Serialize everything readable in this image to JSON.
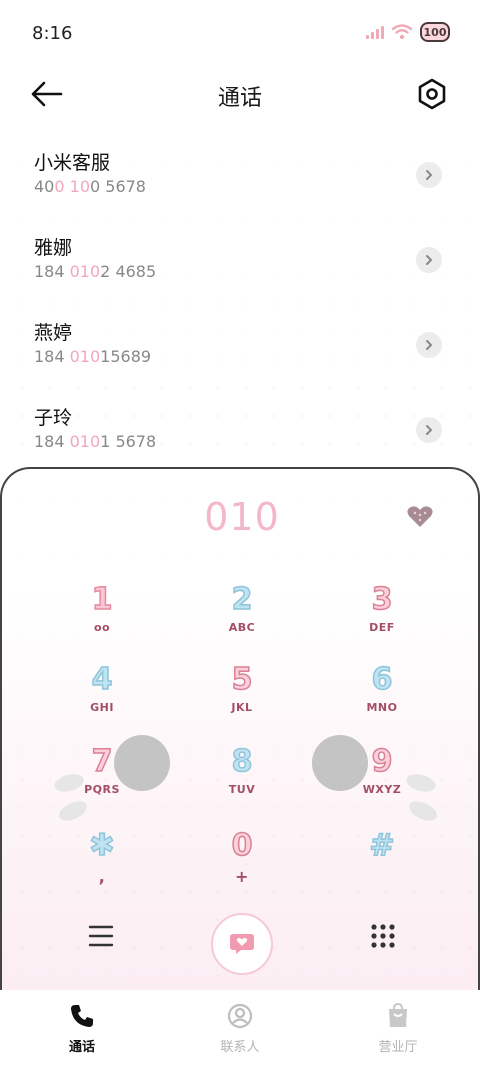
{
  "status_bar": {
    "time": "8:16",
    "battery": "100"
  },
  "header": {
    "title": "通话"
  },
  "contacts": [
    {
      "name": "小米客服",
      "number_parts": [
        "40",
        "0",
        " ",
        "10",
        "0 5678"
      ]
    },
    {
      "name": "雅娜",
      "number_parts": [
        "184 ",
        "010",
        "",
        "",
        "2 4685"
      ]
    },
    {
      "name": "燕婷",
      "number_parts": [
        "184 ",
        "010",
        "",
        "",
        "15689"
      ]
    },
    {
      "name": "子玲",
      "number_parts": [
        "184 ",
        "010",
        "",
        "",
        "1 5678"
      ]
    }
  ],
  "dialer": {
    "input": "010",
    "keys": [
      {
        "digit": "1",
        "letters": "oo"
      },
      {
        "digit": "2",
        "letters": "ABC"
      },
      {
        "digit": "3",
        "letters": "DEF"
      },
      {
        "digit": "4",
        "letters": "GHI"
      },
      {
        "digit": "5",
        "letters": "JKL"
      },
      {
        "digit": "6",
        "letters": "MNO"
      },
      {
        "digit": "7",
        "letters": "PQRS"
      },
      {
        "digit": "8",
        "letters": "TUV"
      },
      {
        "digit": "9",
        "letters": "WXYZ"
      },
      {
        "digit": "✱",
        "letters": ","
      },
      {
        "digit": "0",
        "letters": "+"
      },
      {
        "digit": "#",
        "letters": ""
      }
    ]
  },
  "bottom_nav": {
    "items": [
      {
        "label": "通话",
        "icon": "phone-icon",
        "active": true
      },
      {
        "label": "联系人",
        "icon": "contacts-icon",
        "active": false
      },
      {
        "label": "营业厅",
        "icon": "shop-bag-icon",
        "active": false
      }
    ]
  },
  "colors": {
    "accent_pink": "#f3b8c8",
    "letters": "#a44e65",
    "highlight": "#f2a8ba"
  }
}
